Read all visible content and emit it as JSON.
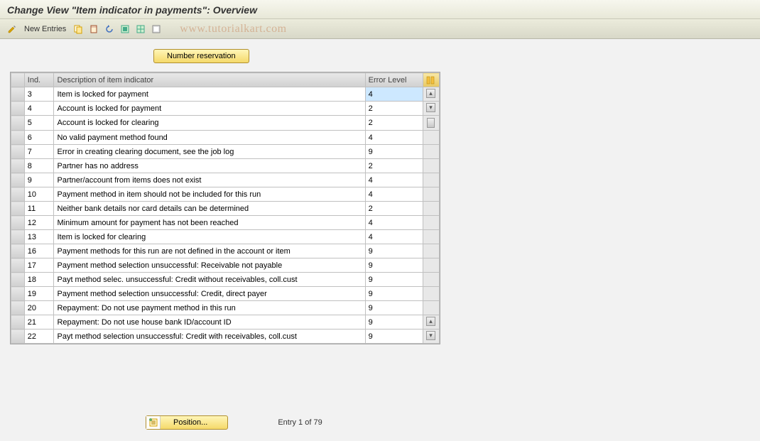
{
  "title": "Change View \"Item indicator in payments\": Overview",
  "toolbar": {
    "new_entries": "New Entries"
  },
  "watermark": "www.tutorialkart.com",
  "buttons": {
    "number_reservation": "Number reservation",
    "position": "Position..."
  },
  "table": {
    "headers": {
      "ind": "Ind.",
      "desc": "Description of item indicator",
      "err": "Error Level"
    },
    "rows": [
      {
        "ind": "3",
        "desc": "Item is locked for payment",
        "err": "4",
        "highlight": true
      },
      {
        "ind": "4",
        "desc": "Account is locked for payment",
        "err": "2"
      },
      {
        "ind": "5",
        "desc": "Account is locked for clearing",
        "err": "2"
      },
      {
        "ind": "6",
        "desc": "No valid payment method found",
        "err": "4"
      },
      {
        "ind": "7",
        "desc": "Error in creating clearing document, see the job log",
        "err": "9"
      },
      {
        "ind": "8",
        "desc": "Partner has no address",
        "err": "2"
      },
      {
        "ind": "9",
        "desc": "Partner/account from items does not exist",
        "err": "4"
      },
      {
        "ind": "10",
        "desc": "Payment method in item should not be included for this run",
        "err": "4"
      },
      {
        "ind": "11",
        "desc": "Neither bank details nor card details can be determined",
        "err": "2"
      },
      {
        "ind": "12",
        "desc": "Minimum amount for payment has not been reached",
        "err": "4"
      },
      {
        "ind": "13",
        "desc": "Item is locked for clearing",
        "err": "4"
      },
      {
        "ind": "16",
        "desc": "Payment methods for this run are not defined in the account or item",
        "err": "9"
      },
      {
        "ind": "17",
        "desc": "Payment method selection unsuccessful: Receivable not payable",
        "err": "9"
      },
      {
        "ind": "18",
        "desc": "Payt method selec. unsuccessful: Credit without receivables, coll.cust",
        "err": "9"
      },
      {
        "ind": "19",
        "desc": "Payment method selection unsuccessful: Credit, direct payer",
        "err": "9"
      },
      {
        "ind": "20",
        "desc": "Repayment: Do not use payment method in this run",
        "err": "9"
      },
      {
        "ind": "21",
        "desc": "Repayment: Do not use house bank ID/account ID",
        "err": "9"
      },
      {
        "ind": "22",
        "desc": "Payt method selection unsuccessful: Credit with receivables, coll.cust",
        "err": "9"
      }
    ]
  },
  "footer": {
    "entry_text": "Entry 1 of 79"
  }
}
